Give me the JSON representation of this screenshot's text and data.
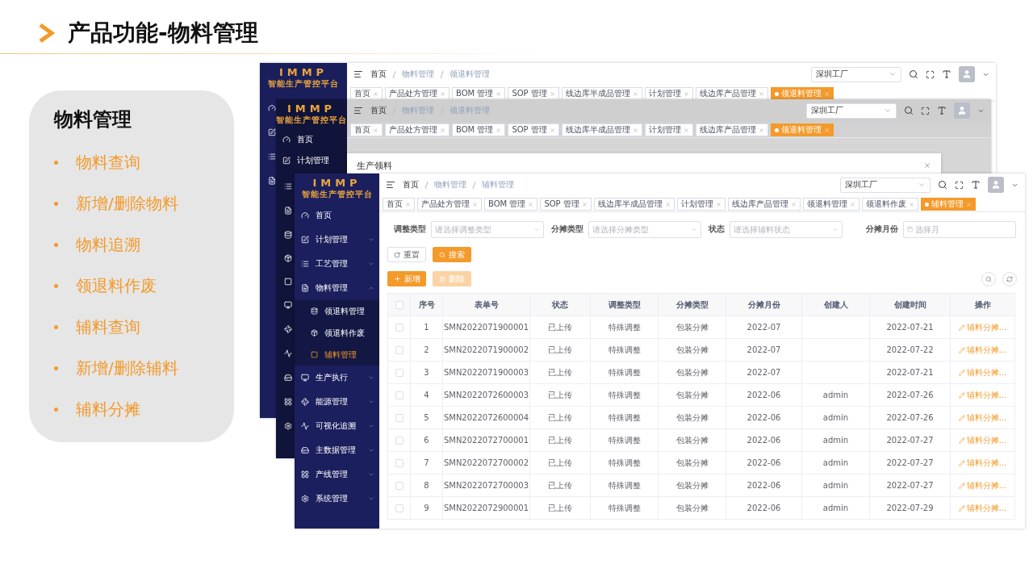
{
  "slide": {
    "title": "产品功能-物料管理"
  },
  "feature_card": {
    "heading": "物料管理",
    "items": [
      "物料查询",
      "新增/删除物料",
      "物料追溯",
      "领退料作废",
      "辅料查询",
      "新增/删除辅料",
      "辅料分摊"
    ]
  },
  "back_window_1": {
    "logo": {
      "title": "IMMP",
      "subtitle": "智能生产管控平台"
    },
    "breadcrumb": [
      "首页",
      "物料管理",
      "领退料管理"
    ],
    "factory": "深圳工厂",
    "tabs": [
      {
        "label": "首页",
        "selected": false
      },
      {
        "label": "产品处方管理",
        "selected": false
      },
      {
        "label": "BOM 管理",
        "selected": false
      },
      {
        "label": "SOP 管理",
        "selected": false
      },
      {
        "label": "线边库半成品管理",
        "selected": false
      },
      {
        "label": "计划管理",
        "selected": false
      },
      {
        "label": "线边库产品管理",
        "selected": false
      },
      {
        "label": "领退料管理",
        "selected": true
      }
    ]
  },
  "back_window_2": {
    "logo": {
      "title": "IMMP",
      "subtitle": "智能生产管控平台"
    },
    "menu": [
      {
        "label": "首页"
      },
      {
        "label": "计划管理"
      }
    ],
    "breadcrumb": [
      "首页",
      "物料管理",
      "领退料管理"
    ],
    "factory": "深圳工厂",
    "tabs": [
      {
        "label": "首页",
        "selected": false
      },
      {
        "label": "产品处方管理",
        "selected": false
      },
      {
        "label": "BOM 管理",
        "selected": false
      },
      {
        "label": "SOP 管理",
        "selected": false
      },
      {
        "label": "线边库半成品管理",
        "selected": false
      },
      {
        "label": "计划管理",
        "selected": false
      },
      {
        "label": "线边库产品管理",
        "selected": false
      },
      {
        "label": "领退料管理",
        "selected": true
      }
    ]
  },
  "dialog": {
    "title": "生产领料"
  },
  "front_window": {
    "logo": {
      "title": "IMMP",
      "subtitle": "智能生产管控平台"
    },
    "menu": [
      {
        "label": "首页",
        "kind": "link"
      },
      {
        "label": "计划管理",
        "kind": "group",
        "expanded": false
      },
      {
        "label": "工艺管理",
        "kind": "group",
        "expanded": false
      },
      {
        "label": "物料管理",
        "kind": "group",
        "expanded": true,
        "children": [
          {
            "label": "领退料管理",
            "selected": false
          },
          {
            "label": "领退料作废",
            "selected": false
          },
          {
            "label": "辅料管理",
            "selected": true
          }
        ]
      },
      {
        "label": "生产执行",
        "kind": "group",
        "expanded": false
      },
      {
        "label": "能源管理",
        "kind": "group",
        "expanded": false
      },
      {
        "label": "可视化追溯",
        "kind": "group",
        "expanded": false
      },
      {
        "label": "主数据管理",
        "kind": "group",
        "expanded": false
      },
      {
        "label": "产线管理",
        "kind": "group",
        "expanded": false
      },
      {
        "label": "系统管理",
        "kind": "group",
        "expanded": false
      }
    ],
    "breadcrumb": [
      "首页",
      "物料管理",
      "辅料管理"
    ],
    "factory": "深圳工厂",
    "tabs": [
      {
        "label": "首页",
        "selected": false
      },
      {
        "label": "产品处方管理",
        "selected": false
      },
      {
        "label": "BOM 管理",
        "selected": false
      },
      {
        "label": "SOP 管理",
        "selected": false
      },
      {
        "label": "线边库半成品管理",
        "selected": false
      },
      {
        "label": "计划管理",
        "selected": false
      },
      {
        "label": "线边库产品管理",
        "selected": false
      },
      {
        "label": "领退料管理",
        "selected": false
      },
      {
        "label": "领退料作废",
        "selected": false
      },
      {
        "label": "辅料管理",
        "selected": true
      }
    ],
    "filters": [
      {
        "label": "调整类型",
        "placeholder": "请选择调整类型",
        "kind": "select"
      },
      {
        "label": "分摊类型",
        "placeholder": "请选择分摊类型",
        "kind": "select"
      },
      {
        "label": "状态",
        "placeholder": "请选择辅料状态",
        "kind": "select"
      },
      {
        "label": "分摊月份",
        "placeholder": "选择月",
        "kind": "date"
      }
    ],
    "search_buttons": [
      {
        "label": "重置",
        "kind": "reset"
      },
      {
        "label": "搜索",
        "kind": "search"
      }
    ],
    "action_buttons": [
      {
        "label": "新增",
        "kind": "add",
        "disabled": false
      },
      {
        "label": "删除",
        "kind": "delete",
        "disabled": true
      }
    ],
    "table": {
      "header_checked": false,
      "columns": [
        "序号",
        "表单号",
        "状态",
        "调整类型",
        "分摊类型",
        "分摊月份",
        "创建人",
        "创建时间",
        "操作"
      ],
      "rows": [
        {
          "checked": false,
          "cells": [
            "1",
            "SMN2022071900001",
            "已上传",
            "特殊调整",
            "包装分摊",
            "2022-07",
            "",
            "2022-07-21",
            "辅料分摊..."
          ]
        },
        {
          "checked": false,
          "cells": [
            "2",
            "SMN2022071900002",
            "已上传",
            "特殊调整",
            "包装分摊",
            "2022-07",
            "",
            "2022-07-22",
            "辅料分摊..."
          ]
        },
        {
          "checked": false,
          "cells": [
            "3",
            "SMN2022071900003",
            "已上传",
            "特殊调整",
            "包装分摊",
            "2022-07",
            "",
            "2022-07-21",
            "辅料分摊..."
          ]
        },
        {
          "checked": false,
          "cells": [
            "4",
            "SMN2022072600003",
            "已上传",
            "特殊调整",
            "包装分摊",
            "2022-06",
            "admin",
            "2022-07-26",
            "辅料分摊..."
          ]
        },
        {
          "checked": false,
          "cells": [
            "5",
            "SMN2022072600004",
            "已上传",
            "特殊调整",
            "包装分摊",
            "2022-06",
            "admin",
            "2022-07-26",
            "辅料分摊..."
          ]
        },
        {
          "checked": false,
          "cells": [
            "6",
            "SMN2022072700001",
            "已上传",
            "特殊调整",
            "包装分摊",
            "2022-06",
            "admin",
            "2022-07-27",
            "辅料分摊..."
          ]
        },
        {
          "checked": false,
          "cells": [
            "7",
            "SMN2022072700002",
            "已上传",
            "特殊调整",
            "包装分摊",
            "2022-06",
            "admin",
            "2022-07-27",
            "辅料分摊..."
          ]
        },
        {
          "checked": false,
          "cells": [
            "8",
            "SMN2022072700003",
            "已上传",
            "特殊调整",
            "包装分摊",
            "2022-06",
            "admin",
            "2022-07-27",
            "辅料分摊..."
          ]
        },
        {
          "checked": false,
          "cells": [
            "9",
            "SMN2022072900001",
            "已上传",
            "特殊调整",
            "包装分摊",
            "2022-06",
            "admin",
            "2022-07-29",
            "辅料分摊..."
          ]
        }
      ]
    }
  }
}
